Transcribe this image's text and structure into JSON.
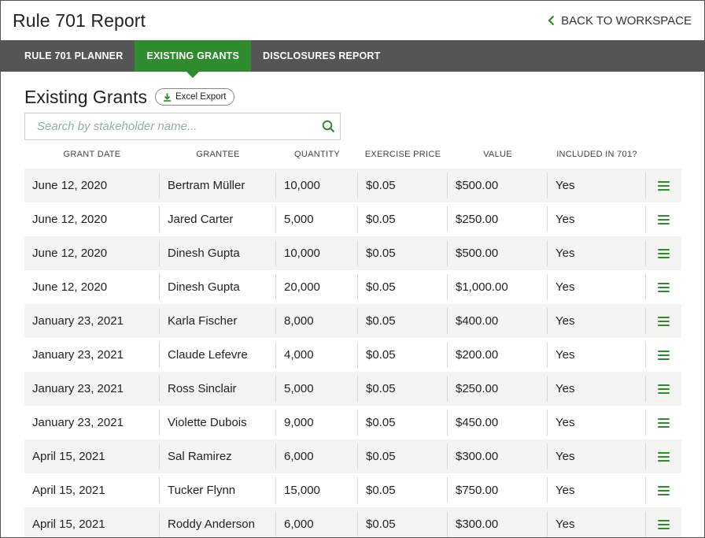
{
  "header": {
    "title": "Rule 701 Report",
    "back_label": "BACK TO WORKSPACE"
  },
  "nav": {
    "tabs": [
      {
        "label": "RULE 701 PLANNER",
        "active": false
      },
      {
        "label": "EXISTING GRANTS",
        "active": true
      },
      {
        "label": "DISCLOSURES REPORT",
        "active": false
      }
    ]
  },
  "main": {
    "title": "Existing Grants",
    "export_label": "Excel Export",
    "search_placeholder": "Search by stakeholder name...",
    "columns": [
      "GRANT DATE",
      "GRANTEE",
      "QUANTITY",
      "EXERCISE PRICE",
      "VALUE",
      "INCLUDED IN 701?"
    ],
    "rows": [
      {
        "date": "June 12, 2020",
        "grantee": "Bertram Müller",
        "quantity": "10,000",
        "price": "$0.05",
        "value": "$500.00",
        "included": "Yes"
      },
      {
        "date": "June 12, 2020",
        "grantee": "Jared Carter",
        "quantity": "5,000",
        "price": "$0.05",
        "value": "$250.00",
        "included": "Yes"
      },
      {
        "date": "June 12, 2020",
        "grantee": "Dinesh Gupta",
        "quantity": "10,000",
        "price": "$0.05",
        "value": "$500.00",
        "included": "Yes"
      },
      {
        "date": "June 12, 2020",
        "grantee": "Dinesh Gupta",
        "quantity": "20,000",
        "price": "$0.05",
        "value": "$1,000.00",
        "included": "Yes"
      },
      {
        "date": "January 23, 2021",
        "grantee": "Karla Fischer",
        "quantity": "8,000",
        "price": "$0.05",
        "value": "$400.00",
        "included": "Yes"
      },
      {
        "date": "January 23, 2021",
        "grantee": "Claude Lefevre",
        "quantity": "4,000",
        "price": "$0.05",
        "value": "$200.00",
        "included": "Yes"
      },
      {
        "date": "January 23, 2021",
        "grantee": "Ross Sinclair",
        "quantity": "5,000",
        "price": "$0.05",
        "value": "$250.00",
        "included": "Yes"
      },
      {
        "date": "January 23, 2021",
        "grantee": "Violette Dubois",
        "quantity": "9,000",
        "price": "$0.05",
        "value": "$450.00",
        "included": "Yes"
      },
      {
        "date": "April 15, 2021",
        "grantee": "Sal Ramirez",
        "quantity": "6,000",
        "price": "$0.05",
        "value": "$300.00",
        "included": "Yes"
      },
      {
        "date": "April 15, 2021",
        "grantee": "Tucker Flynn",
        "quantity": "15,000",
        "price": "$0.05",
        "value": "$750.00",
        "included": "Yes"
      },
      {
        "date": "April 15, 2021",
        "grantee": "Roddy Anderson",
        "quantity": "6,000",
        "price": "$0.05",
        "value": "$300.00",
        "included": "Yes"
      }
    ]
  },
  "colors": {
    "accent": "#2e8b2e",
    "nav_bg": "#555555",
    "row_alt": "#f4f4f2"
  },
  "icons": {
    "back": "chevron-left-icon",
    "export": "download-icon",
    "search": "search-icon",
    "row_menu": "hamburger-menu-icon"
  }
}
